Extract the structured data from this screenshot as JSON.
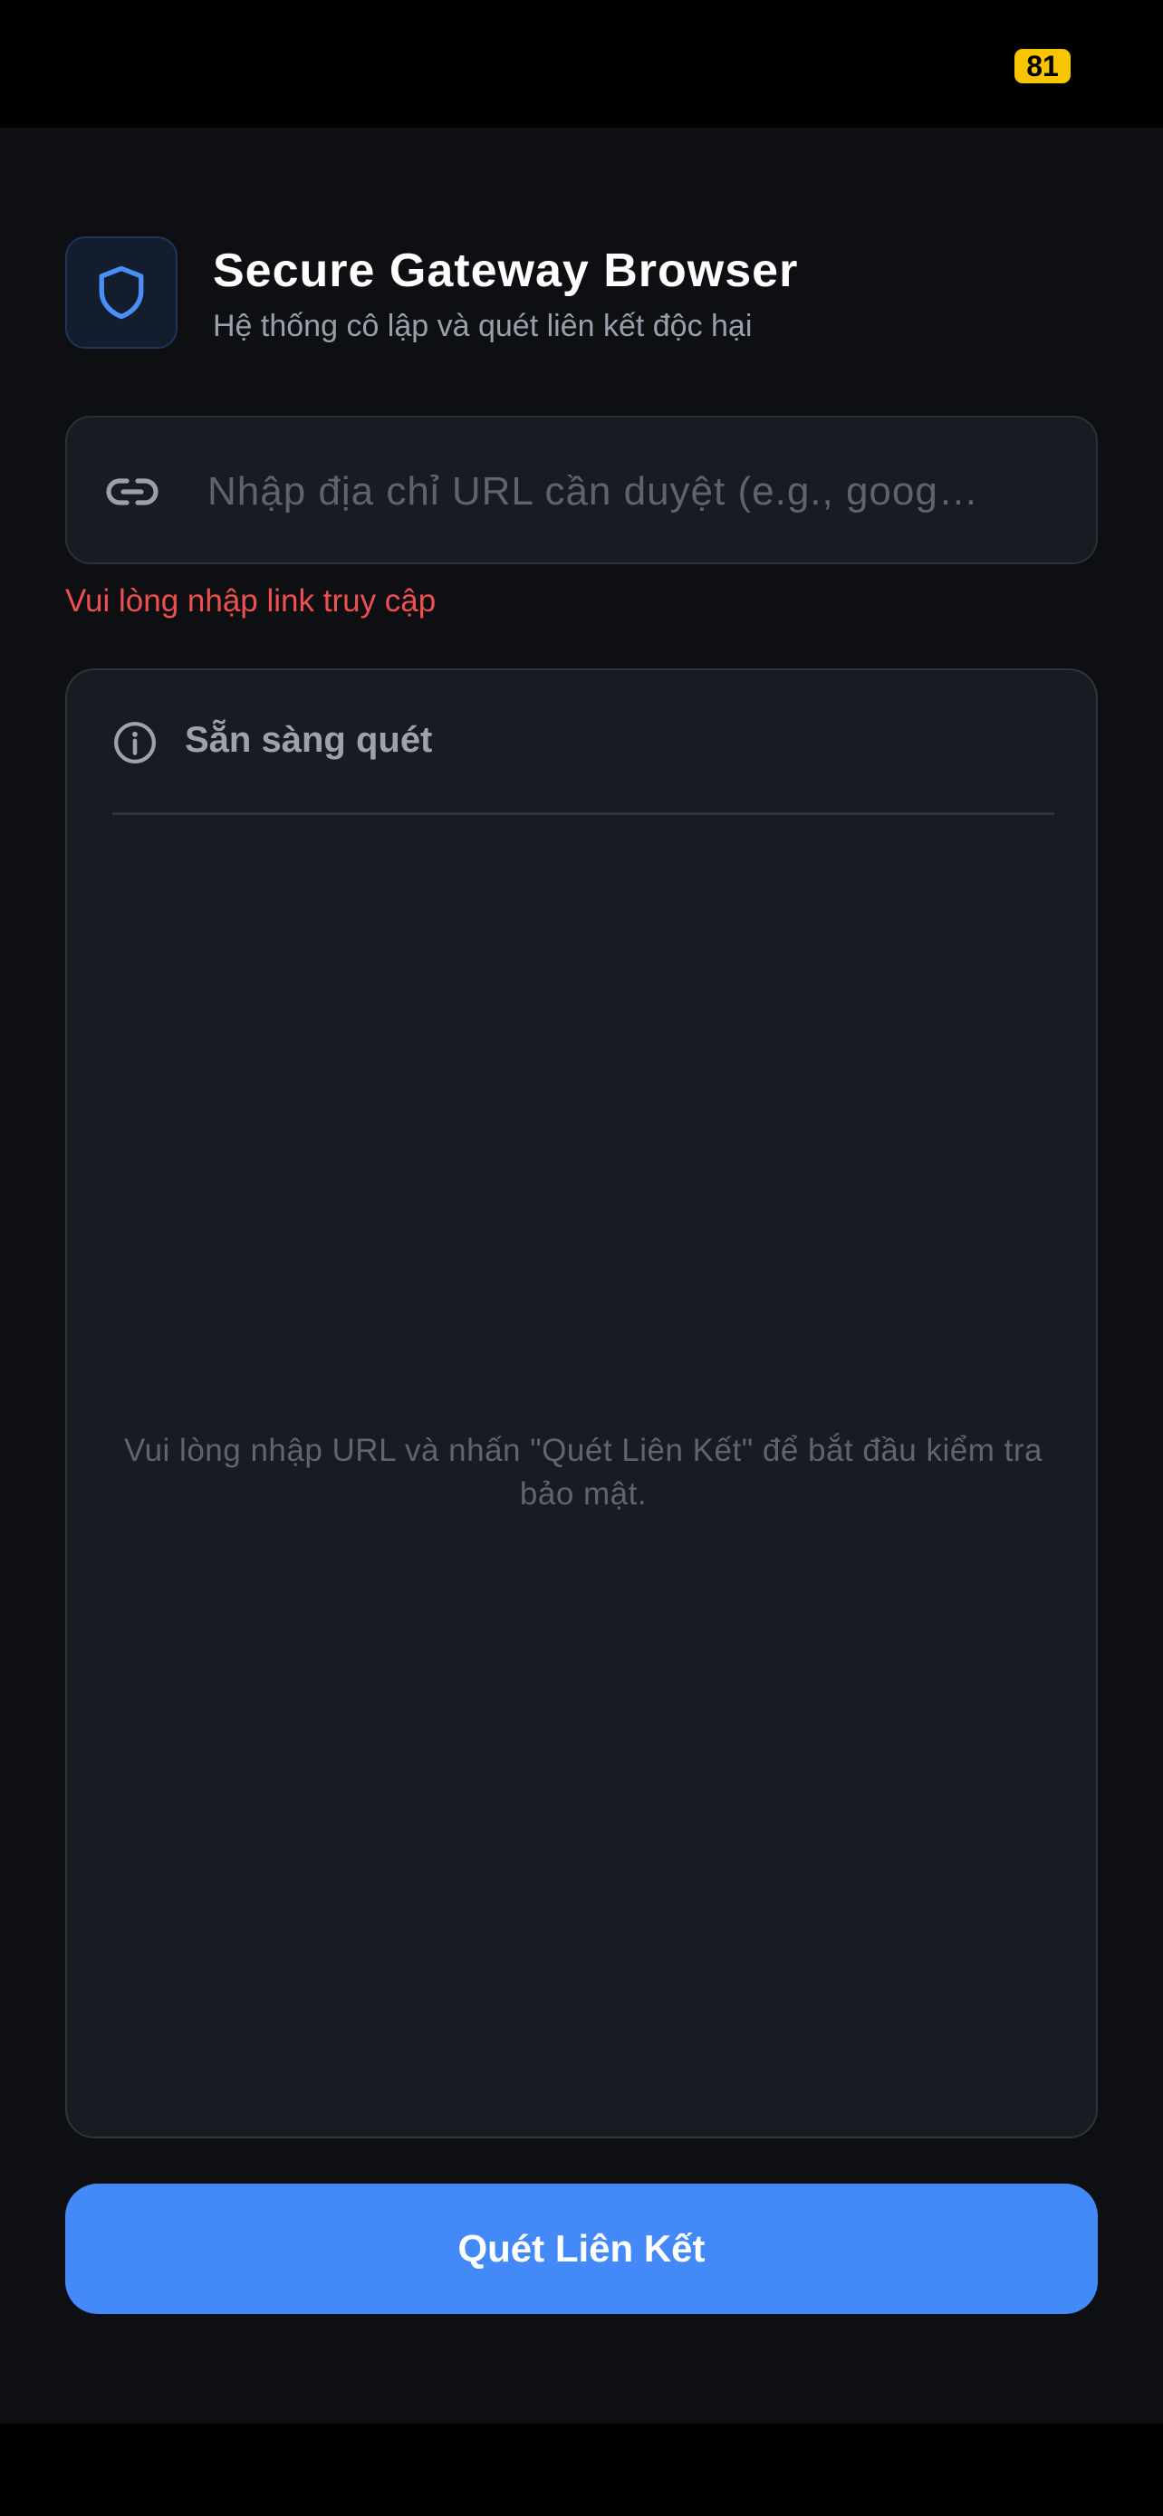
{
  "status_bar": {
    "battery_level": "81",
    "battery_color": "#f7c600"
  },
  "header": {
    "logo_icon": "shield-icon",
    "title": "Secure Gateway Browser",
    "subtitle": "Hệ thống cô lập và quét liên kết độc hại"
  },
  "url_field": {
    "icon": "link-icon",
    "value": "",
    "placeholder": "Nhập địa chỉ URL cần duyệt (e.g., goog…",
    "error": "Vui lòng nhập link truy cập"
  },
  "result_panel": {
    "status_icon": "info-icon",
    "status": "Sẵn sàng quét",
    "message": "Vui lòng nhập URL và nhấn \"Quét Liên Kết\" để bắt đầu kiểm tra bảo mật."
  },
  "scan_button": {
    "label": "Quét Liên Kết"
  },
  "colors": {
    "accent": "#4489f8",
    "error": "#ef4f4f",
    "background": "#0d0f13",
    "panel": "#181b22"
  }
}
